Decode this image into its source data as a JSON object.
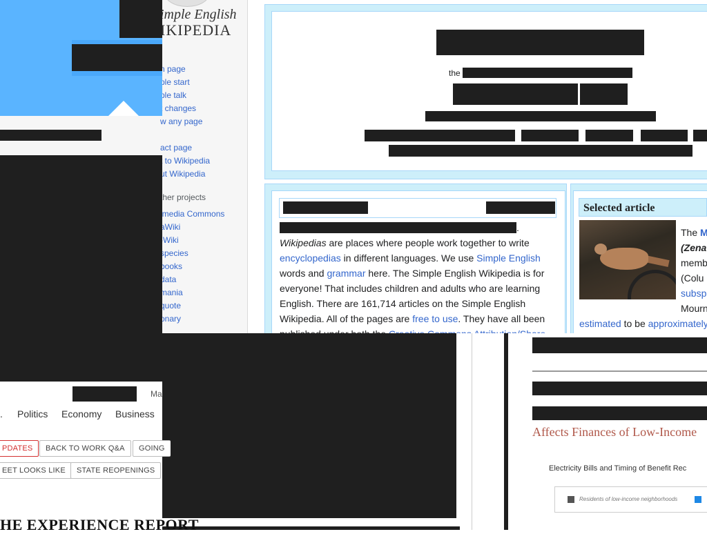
{
  "wiki": {
    "logo_line1": "imple English",
    "logo_line2": "IKIPEDIA",
    "nav": [
      "n page",
      "ple start",
      "ple talk",
      "t changes",
      "w any page",
      "act page",
      "t to Wikipedia",
      "ut Wikipedia"
    ],
    "other_projects_heading": "ther projects",
    "projects": [
      "imedia Commons",
      "aWiki",
      "-Wiki",
      "species",
      "books",
      "data",
      "mania",
      "quote",
      "onary"
    ],
    "the_word": "the",
    "intro_paragraph": {
      "lead": "Wikipedias",
      "t1": " are places where people work together to write ",
      "l1": "encyclopedias",
      "t2": " in different languages. We use ",
      "l2": "Simple English",
      "t3": " words and ",
      "l3": "grammar",
      "t4": " here. The Simple English Wikipedia is for everyone! That includes children and adults who are learning English. There are 161,714 articles on the Simple English Wikipedia. All of the pages are ",
      "l4": "free to use",
      "t5": ". They have all been published under both the ",
      "l5": "Creative Commons Attribution/Share"
    },
    "selected_article": {
      "heading": "Selected article",
      "line1_prefix": "The ",
      "line1_link": "M",
      "line2": "(Zena",
      "line3": "memb",
      "line4": "(Colu",
      "line5_link": "subsp",
      "line6": "Mourn",
      "line7_link1": "estimated",
      "line7_mid": " to be ",
      "line7_link2": "approximately"
    }
  },
  "news": {
    "top_link": "Ma",
    "nav": [
      ".",
      "Politics",
      "Economy",
      "Business"
    ],
    "tags_row1": [
      "PDATES",
      "BACK TO WORK Q&A",
      "GOING"
    ],
    "tags_row2": [
      "EET LOOKS LIKE",
      "STATE REOPENINGS"
    ],
    "feature": "HE EXPERIENCE REPORT"
  },
  "article": {
    "headline_fragment": "Affects Finances of Low-Income",
    "chart_title": "Electricity Bills and Timing of Benefit Rec",
    "legend": [
      "Residents of low-income neighborhoods"
    ],
    "colors": {
      "legend_gray": "#555555",
      "legend_blue": "#1e88e5"
    }
  }
}
